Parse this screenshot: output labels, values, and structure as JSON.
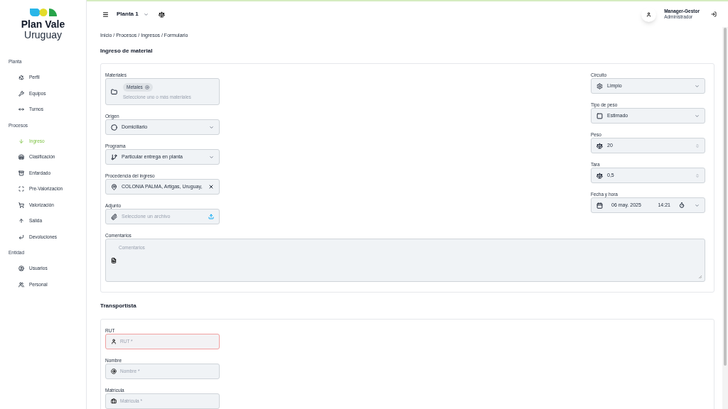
{
  "sidebar": {
    "logo": {
      "line1": "Plan Vale",
      "line2": "Uruguay"
    },
    "sections": [
      {
        "title": "Planta",
        "items": [
          {
            "label": "Perfil",
            "selected": false
          },
          {
            "label": "Equipos",
            "selected": false
          },
          {
            "label": "Turnos",
            "selected": false
          }
        ]
      },
      {
        "title": "Procesos",
        "items": [
          {
            "label": "Ingreso",
            "selected": true
          },
          {
            "label": "Clasificación",
            "selected": false
          },
          {
            "label": "Enfardado",
            "selected": false
          },
          {
            "label": "Pre-Valorización",
            "selected": false
          },
          {
            "label": "Valorización",
            "selected": false
          },
          {
            "label": "Salida",
            "selected": false
          },
          {
            "label": "Devoluciones",
            "selected": false
          }
        ]
      },
      {
        "title": "Entidad",
        "items": [
          {
            "label": "Usuarios",
            "selected": false
          },
          {
            "label": "Personal",
            "selected": false
          }
        ]
      }
    ]
  },
  "topbar": {
    "plant": "Planta 1",
    "user": {
      "name": "Manager-Gestor",
      "role": "Administrador"
    }
  },
  "breadcrumb": "Inicio / Procesos / Ingresos / Formulario",
  "material": {
    "title": "Ingreso de material",
    "left_fields": [
      {
        "kind": "chips",
        "label": "Materiales",
        "chips": [
          "Metales"
        ],
        "placeholder": "Seleccione uno o más materiales"
      },
      {
        "kind": "select",
        "label": "Origen",
        "value": "Domiciliario"
      },
      {
        "kind": "select",
        "label": "Programa",
        "value": "Particular entrega en planta"
      },
      {
        "kind": "place",
        "label": "Procedencia del ingreso",
        "value": "COLONIA PALMA, Artigas, Uruguay,"
      },
      {
        "kind": "file",
        "label": "Adjunto",
        "placeholder": "Seleccione un archivo"
      }
    ],
    "right_fields": [
      {
        "kind": "select",
        "label": "Circuito",
        "value": "Limpio"
      },
      {
        "kind": "select",
        "label": "Tipo de peso",
        "value": "Estimado"
      },
      {
        "kind": "number",
        "label": "Peso",
        "value": "20"
      },
      {
        "kind": "number",
        "label": "Tara",
        "value": "0,5"
      },
      {
        "kind": "datetime",
        "label": "Fecha y hora",
        "date": "06 may. 2025",
        "time": "14:21"
      }
    ],
    "comments": {
      "label": "Comentarios",
      "placeholder": "Comentarios"
    }
  },
  "carrier": {
    "title": "Transportista",
    "fields": [
      {
        "label": "RUT",
        "placeholder": "RUT *",
        "error": true
      },
      {
        "label": "Nombre",
        "placeholder": "Nombre *",
        "error": false
      },
      {
        "label": "Matrícula",
        "placeholder": "Matrícula *",
        "error": false
      }
    ]
  }
}
